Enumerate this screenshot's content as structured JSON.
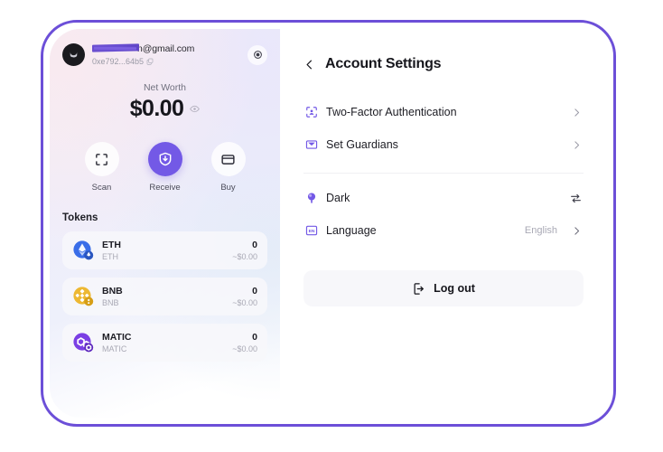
{
  "wallet": {
    "account": {
      "email": "n@gmail.com",
      "email_redacted": true,
      "address": "0xe792...64b5",
      "avatar_icon": "user-avatar-icon",
      "copy_icon": "copy-icon",
      "settings_icon": "gear-icon"
    },
    "net_worth": {
      "label": "Net Worth",
      "value": "$0.00",
      "visibility_icon": "eye-icon"
    },
    "actions": [
      {
        "label": "Scan",
        "icon": "scan-icon",
        "primary": false
      },
      {
        "label": "Receive",
        "icon": "receive-icon",
        "primary": true
      },
      {
        "label": "Buy",
        "icon": "card-icon",
        "primary": false
      }
    ],
    "tokens_title": "Tokens",
    "tokens": [
      {
        "symbol": "ETH",
        "name": "ETH",
        "amount": "0",
        "fiat": "~$0.00",
        "color": "#3a6ee8",
        "icon": "eth-token-icon"
      },
      {
        "symbol": "BNB",
        "name": "BNB",
        "amount": "0",
        "fiat": "~$0.00",
        "color": "#edb832",
        "icon": "bnb-token-icon"
      },
      {
        "symbol": "MATIC",
        "name": "MATIC",
        "amount": "0",
        "fiat": "~$0.00",
        "color": "#7b3fe4",
        "icon": "matic-token-icon"
      }
    ]
  },
  "settings": {
    "title": "Account Settings",
    "back_icon": "chevron-left-icon",
    "rows": [
      {
        "label": "Two-Factor Authentication",
        "icon": "face-scan-icon",
        "value": "",
        "control": "chevron"
      },
      {
        "label": "Set Guardians",
        "icon": "guardian-shield-icon",
        "value": "",
        "control": "chevron"
      },
      {
        "label": "Dark",
        "icon": "theme-balloon-icon",
        "value": "",
        "control": "swap"
      },
      {
        "label": "Language",
        "icon": "language-icon",
        "value": "English",
        "control": "chevron"
      }
    ],
    "logout": {
      "label": "Log out",
      "icon": "logout-icon"
    }
  },
  "theme": {
    "accent": "#7359e6",
    "frame_border": "#6c4fd8",
    "text_primary": "#16161c",
    "text_muted": "#a9a9b5"
  }
}
